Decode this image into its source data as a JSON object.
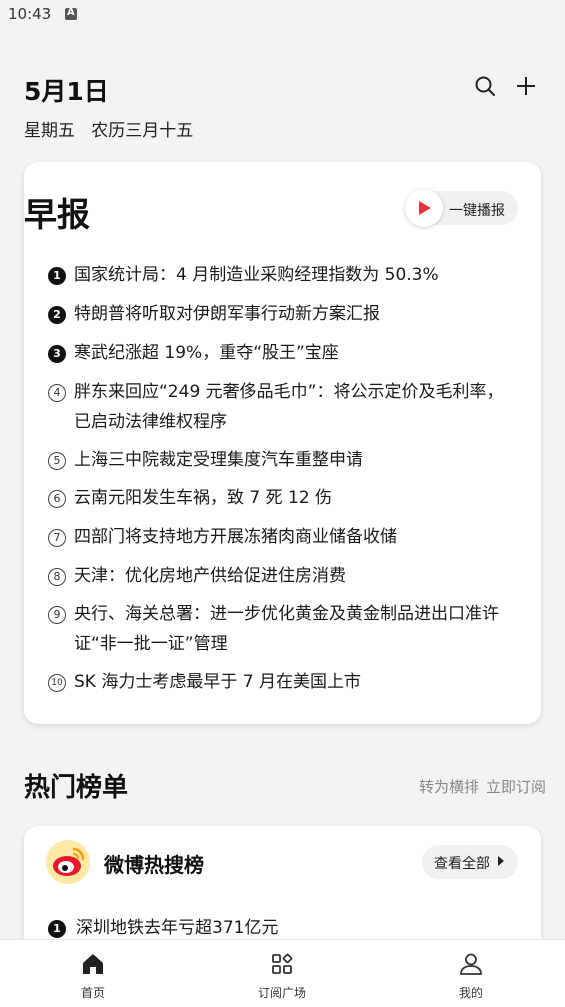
{
  "status_bar": {
    "time": "10:43"
  },
  "header": {
    "date": "5月1日",
    "subtitle": "星期五   农历三月十五",
    "search_icon": "search-icon",
    "add_icon": "plus-icon"
  },
  "brief": {
    "title": "早报",
    "play_label": "一键播报",
    "items": [
      {
        "num": "1",
        "text": "国家统计局：4 月制造业采购经理指数为 50.3%"
      },
      {
        "num": "2",
        "text": "特朗普将听取对伊朗军事行动新方案汇报"
      },
      {
        "num": "3",
        "text": "寒武纪涨超 19%，重夺“股王”宝座"
      },
      {
        "num": "4",
        "text": "胖东来回应“249 元奢侈品毛巾”：将公示定价及毛利率，已启动法律维权程序"
      },
      {
        "num": "5",
        "text": "上海三中院裁定受理集度汽车重整申请"
      },
      {
        "num": "6",
        "text": "云南元阳发生车祸，致 7 死 12 伤"
      },
      {
        "num": "7",
        "text": "四部门将支持地方开展冻猪肉商业储备收储"
      },
      {
        "num": "8",
        "text": "天津：优化房地产供给促进住房消费"
      },
      {
        "num": "9",
        "text": "央行、海关总署：进一步优化黄金及黄金制品进出口准许证“非一批一证”管理"
      },
      {
        "num": "10",
        "text": "SK 海力士考虑最早于 7 月在美国上市"
      }
    ]
  },
  "hot_lists": {
    "title": "热门榜单",
    "switch_label": "转为横排",
    "subscribe_label": "立即订阅",
    "weibo": {
      "title": "微博热搜榜",
      "view_all": "查看全部",
      "first_item": {
        "num": "1",
        "text": "深圳地铁去年亏超371亿元"
      }
    }
  },
  "tabbar": {
    "tabs": [
      {
        "label": "首页",
        "icon": "home-icon"
      },
      {
        "label": "订阅广场",
        "icon": "grid-icon"
      },
      {
        "label": "我的",
        "icon": "person-icon"
      }
    ]
  }
}
